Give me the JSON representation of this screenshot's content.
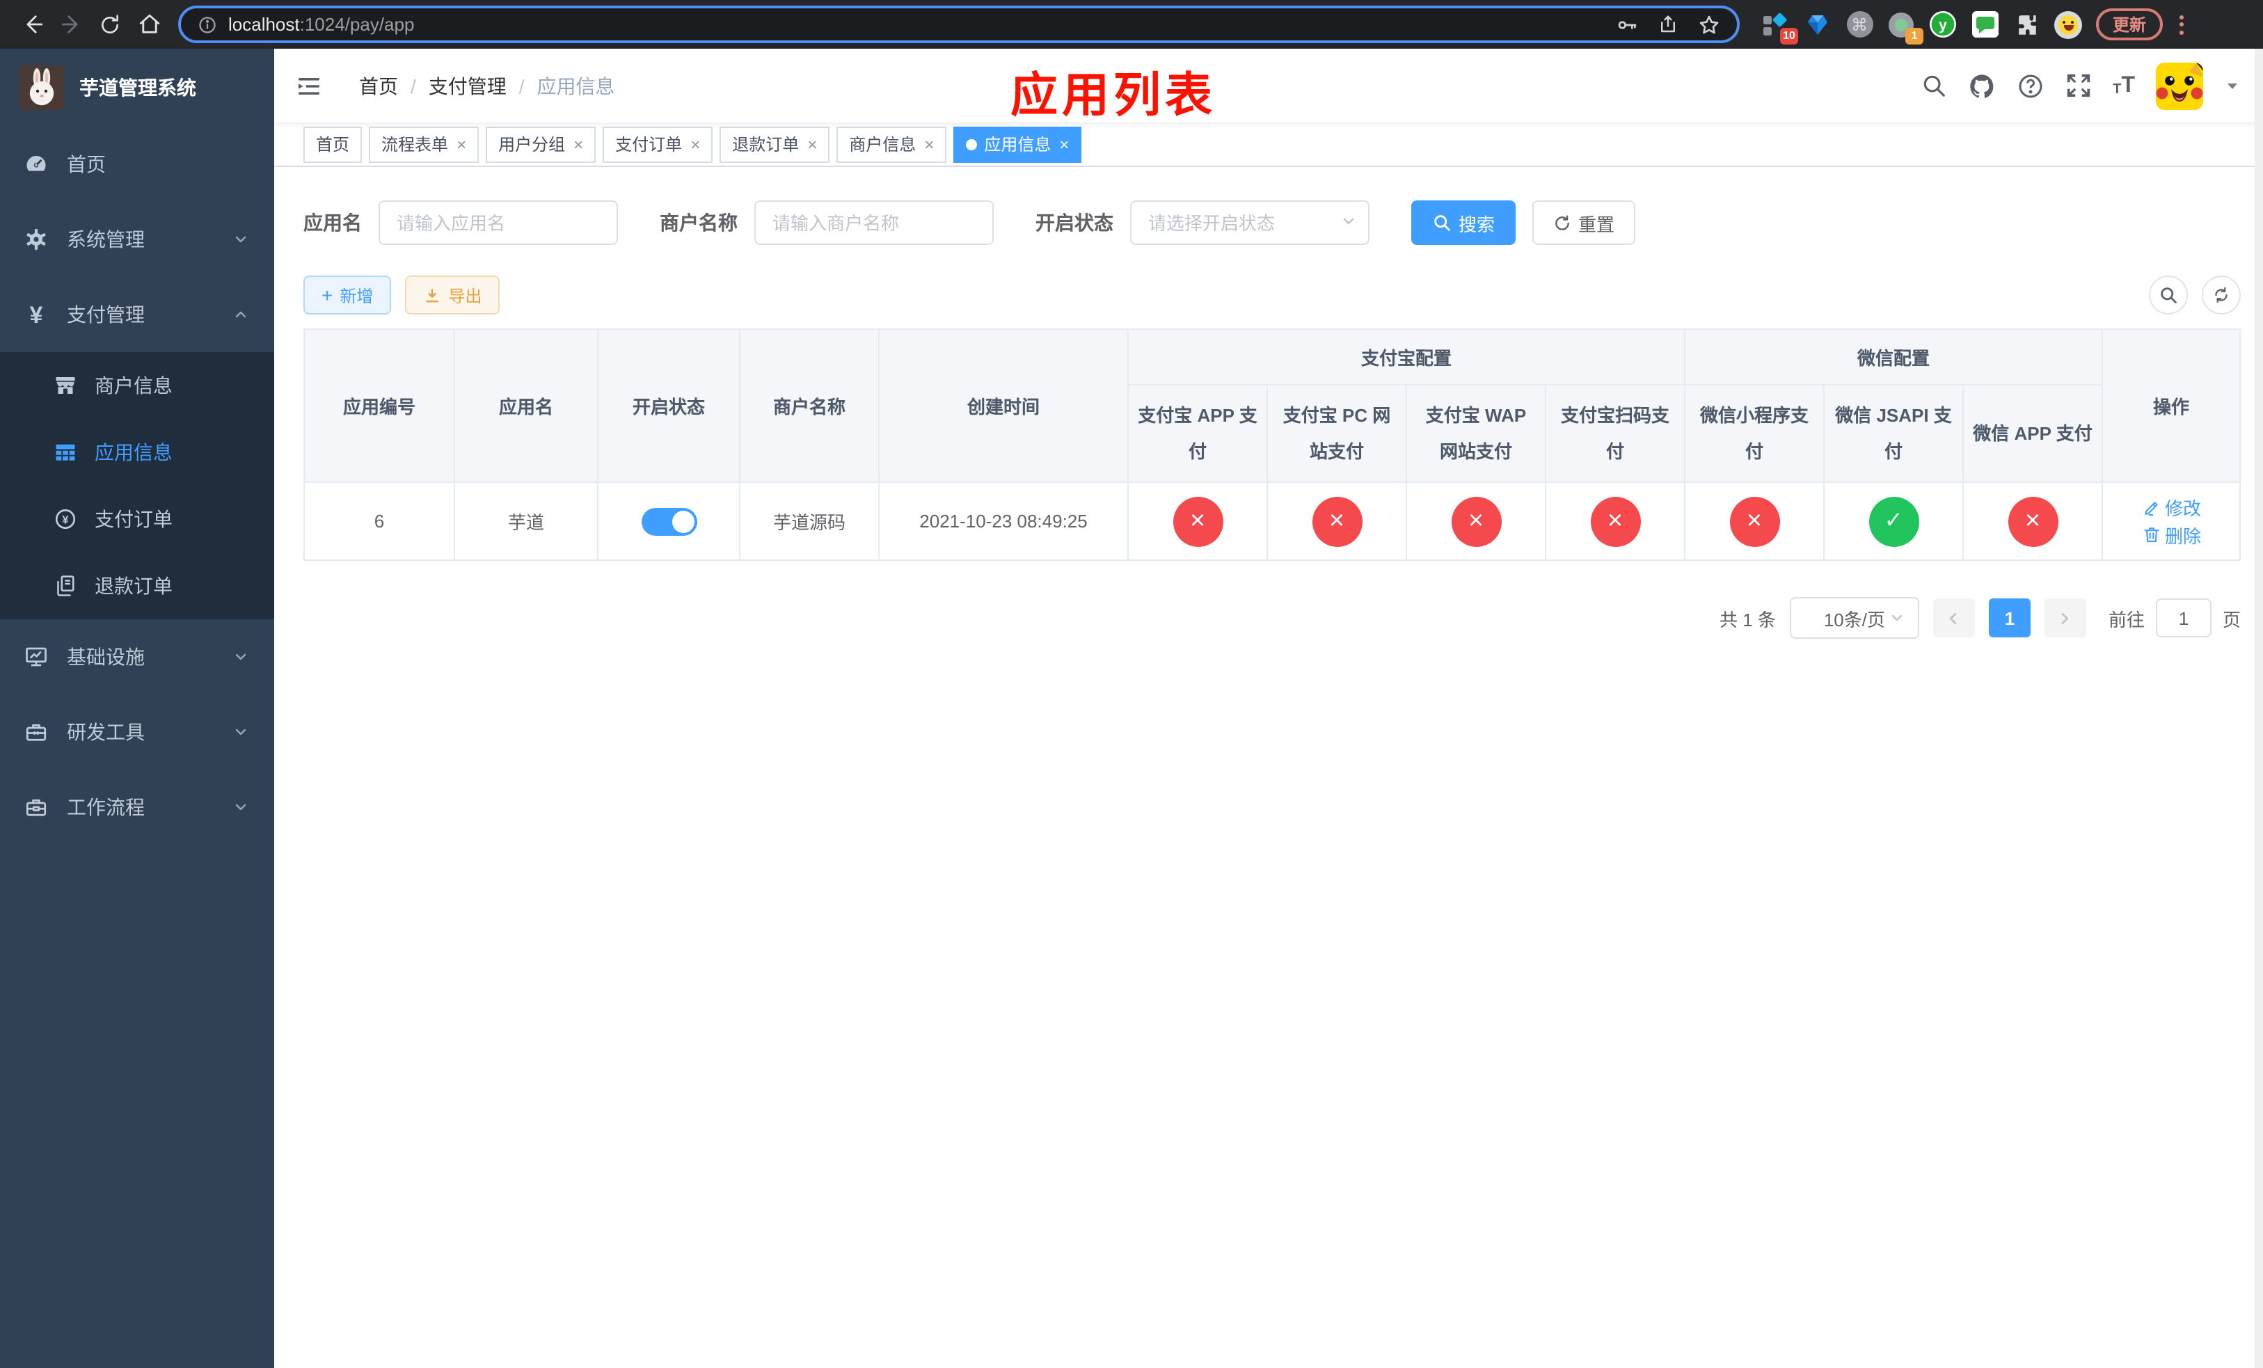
{
  "browser": {
    "url_host": "localhost",
    "url_path": ":1024/pay/app",
    "update_label": "更新",
    "ext_badge_pin": "10",
    "ext_badge_rec": "1",
    "ext_y_label": "y"
  },
  "sidebar": {
    "title": "芋道管理系统",
    "menu": [
      {
        "label": "首页",
        "icon": "dashboard-icon",
        "expandable": false,
        "expanded": false
      },
      {
        "label": "系统管理",
        "icon": "gear-icon",
        "expandable": true,
        "expanded": false
      },
      {
        "label": "支付管理",
        "icon": "yen-icon",
        "expandable": true,
        "expanded": true
      },
      {
        "label": "基础设施",
        "icon": "monitor-icon",
        "expandable": true,
        "expanded": false
      },
      {
        "label": "研发工具",
        "icon": "toolbox-icon",
        "expandable": true,
        "expanded": false
      },
      {
        "label": "工作流程",
        "icon": "briefcase-icon",
        "expandable": true,
        "expanded": false
      }
    ],
    "pay_submenu": [
      {
        "label": "商户信息",
        "icon": "storefront-icon",
        "active": false
      },
      {
        "label": "应用信息",
        "icon": "grid-icon",
        "active": true
      },
      {
        "label": "支付订单",
        "icon": "coin-icon",
        "active": false
      },
      {
        "label": "退款订单",
        "icon": "document-icon",
        "active": false
      }
    ]
  },
  "header": {
    "breadcrumb": [
      "首页",
      "支付管理",
      "应用信息"
    ],
    "annotation": "应用列表"
  },
  "tabs": [
    {
      "label": "首页",
      "closable": false,
      "active": false
    },
    {
      "label": "流程表单",
      "closable": true,
      "active": false
    },
    {
      "label": "用户分组",
      "closable": true,
      "active": false
    },
    {
      "label": "支付订单",
      "closable": true,
      "active": false
    },
    {
      "label": "退款订单",
      "closable": true,
      "active": false
    },
    {
      "label": "商户信息",
      "closable": true,
      "active": false
    },
    {
      "label": "应用信息",
      "closable": true,
      "active": true
    }
  ],
  "filters": {
    "app_name_label": "应用名",
    "app_name_placeholder": "请输入应用名",
    "merchant_label": "商户名称",
    "merchant_placeholder": "请输入商户名称",
    "status_label": "开启状态",
    "status_placeholder": "请选择开启状态",
    "search_label": "搜索",
    "reset_label": "重置"
  },
  "toolbar": {
    "add_label": "新增",
    "export_label": "导出"
  },
  "table": {
    "columns": [
      "应用编号",
      "应用名",
      "开启状态",
      "商户名称",
      "创建时间"
    ],
    "group_alipay": "支付宝配置",
    "group_wechat": "微信配置",
    "alipay_columns": [
      "支付宝 APP 支付",
      "支付宝 PC 网站支付",
      "支付宝 WAP 网站支付",
      "支付宝扫码支付"
    ],
    "wechat_columns": [
      "微信小程序支付",
      "微信 JSAPI 支付",
      "微信 APP 支付"
    ],
    "actions_column": "操作",
    "rows": [
      {
        "id": "6",
        "name": "芋道",
        "enabled": true,
        "merchant": "芋道源码",
        "created": "2021-10-23 08:49:25",
        "channels": [
          false,
          false,
          false,
          false,
          false,
          true,
          false
        ],
        "edit_label": "修改",
        "delete_label": "删除"
      }
    ]
  },
  "pagination": {
    "total": "共 1 条",
    "page_size": "10条/页",
    "current": "1",
    "goto_label": "前往",
    "goto_value": "1",
    "page_label": "页"
  },
  "colors": {
    "accent": "#409eff",
    "danger": "#f4494d",
    "success": "#21c45d",
    "warning": "#e6a23c",
    "sidebar_bg": "#304156",
    "submenu_bg": "#1f2d3d"
  }
}
